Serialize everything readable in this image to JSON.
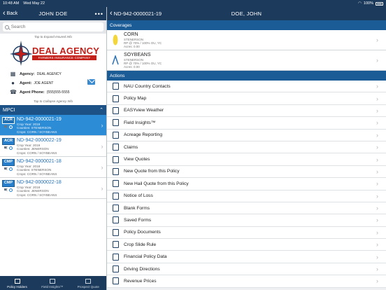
{
  "status": {
    "time": "10:48 AM",
    "date": "Wed May 22",
    "battery": "100%"
  },
  "left": {
    "back_label": "Back",
    "title": "JOHN DOE",
    "more": "•••",
    "search_placeholder": "Search",
    "expand_hint": "Tap to Expand Insured Info",
    "collapse_hint": "Tap to Collapse Agency Info",
    "logo": {
      "brand": "DEAL AGENCY",
      "sub": "FARMERS INSURANCE COMPANY"
    },
    "agency": [
      {
        "label": "Agency:",
        "value": "DEAL AGENCY",
        "icon": "building-icon"
      },
      {
        "label": "Agent:",
        "value": "JOE AGENT",
        "icon": "person-icon"
      },
      {
        "label": "Agent Phone:",
        "value": "(555)555-5555",
        "icon": "phone-icon"
      }
    ],
    "section_title": "MPCI",
    "policies": [
      {
        "tag": "ACR",
        "id": "ND-942-0000021-19",
        "lines": [
          "Crop Year: 2019",
          "Counties: STENERSON",
          "Crops: CORN / SOYBEANS"
        ],
        "selected": true
      },
      {
        "tag": "ACR",
        "id": "ND-942-0000022-19",
        "lines": [
          "Crop Year: 2019",
          "Counties: JENERSON",
          "Crops: CORN / SOYBEANS"
        ],
        "selected": false
      },
      {
        "tag": "CMP",
        "id": "ND-942-0000021-18",
        "lines": [
          "Crop Year: 2018",
          "Counties: STENERSON",
          "Crops: CORN / SOYBEANS"
        ],
        "selected": false
      },
      {
        "tag": "CMP",
        "id": "ND-942-0000022-18",
        "lines": [
          "Crop Year: 2018",
          "Counties: JENERSON",
          "Crops: CORN / SOYBEANS"
        ],
        "selected": false
      }
    ],
    "tabs": [
      {
        "label": "Policy Holders",
        "active": true
      },
      {
        "label": "Field Insights™",
        "active": false
      },
      {
        "label": "Prospect Quote",
        "active": false
      }
    ]
  },
  "right": {
    "back_label": "ND-942-0000021-19",
    "title": "DOE, JOHN",
    "coverages_header": "Coverages",
    "coverages": [
      {
        "name": "CORN",
        "lines": [
          "STENERSON",
          "RP @ 70% / 100% OU, YC",
          "Acres: 0.00"
        ],
        "icon": "corn-icon"
      },
      {
        "name": "SOYBEANS",
        "lines": [
          "STENERSON",
          "RP @ 70% / 100% OU, YC",
          "Acres: 0.00"
        ],
        "icon": "soybean-icon"
      }
    ],
    "actions_header": "Actions",
    "actions": [
      {
        "label": "NAU Country Contacts",
        "icon": "contacts-icon"
      },
      {
        "label": "Policy Map",
        "icon": "map-icon"
      },
      {
        "label": "EASYview Weather",
        "icon": "weather-icon"
      },
      {
        "label": "Field Insights™",
        "icon": "field-icon"
      },
      {
        "label": "Acreage Reporting",
        "icon": "acreage-icon"
      },
      {
        "label": "Claims",
        "icon": "claims-icon"
      },
      {
        "label": "View Quotes",
        "icon": "quotes-icon"
      },
      {
        "label": "New Quote from this Policy",
        "icon": "new-quote-icon"
      },
      {
        "label": "New Hail Quote from this Policy",
        "icon": "hail-quote-icon"
      },
      {
        "label": "Notice of Loss",
        "icon": "notice-icon"
      },
      {
        "label": "Blank Forms",
        "icon": "forms-icon"
      },
      {
        "label": "Saved Forms",
        "icon": "saved-forms-icon"
      },
      {
        "label": "Policy Documents",
        "icon": "documents-icon"
      },
      {
        "label": "Crop Slide Rule",
        "icon": "slide-rule-icon"
      },
      {
        "label": "Financial Policy Data",
        "icon": "financial-icon"
      },
      {
        "label": "Driving Directions",
        "icon": "directions-icon"
      },
      {
        "label": "Revenue Prices",
        "icon": "revenue-icon"
      }
    ]
  }
}
